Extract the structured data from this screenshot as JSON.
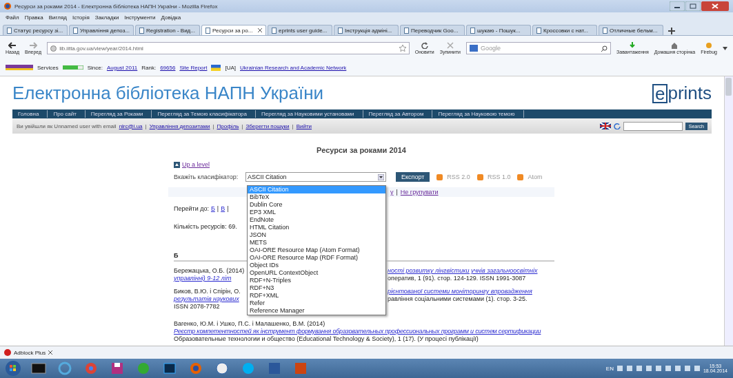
{
  "window": {
    "title": "Ресурси за роками 2014 - Електронна бібліотека НАПН України - Mozilla Firefox"
  },
  "menu": [
    "Файл",
    "Правка",
    "Вигляд",
    "Історія",
    "Закладки",
    "Інструменти",
    "Довідка"
  ],
  "tabs": [
    {
      "label": "Статус ресурсу зі...",
      "selected": false
    },
    {
      "label": "Управління депоз...",
      "selected": false
    },
    {
      "label": "Registration - Вид...",
      "selected": false
    },
    {
      "label": "Ресурси за ро...",
      "selected": true
    },
    {
      "label": "eprints user guide...",
      "selected": false
    },
    {
      "label": "Інструкція адміні...",
      "selected": false
    },
    {
      "label": "Переводчик Goo...",
      "selected": false
    },
    {
      "label": "шукаю - Пошук...",
      "selected": false
    },
    {
      "label": "Кроссовки с нат...",
      "selected": false
    },
    {
      "label": "Отличные бельм...",
      "selected": false
    }
  ],
  "toolbar": {
    "back": "Назад",
    "forward": "Вперед",
    "url": "lib.iitta.gov.ua/view/year/2014.html",
    "reload": "Оновити",
    "stop": "Зупинити",
    "search_placeholder": "Google",
    "downloads": "Завантаження",
    "home": "Домашня сторінка",
    "firebug": "Firebug"
  },
  "bookmarks": {
    "services": "Services",
    "since": "Since:",
    "since_date": "August 2011",
    "rank": "Rank:",
    "rank_value": "69656",
    "site_report": "Site Report",
    "network": "[UA]",
    "network_link": "Ukrainian Research and Academic Network"
  },
  "site": {
    "title": "Електронна бібліотека НАПН України",
    "logo_letter": "e",
    "logo_rest": "prints",
    "nav": [
      "Головна",
      "Про сайт",
      "Перегляд за Роками",
      "Перегляд за Темою класифікатора",
      "Перегляд за Науковими установами",
      "Перегляд за Автором",
      "Перегляд за Науковою темою"
    ],
    "login_text": "Ви увійшли як Unnamed user with email",
    "email": "nlrc@i.ua",
    "separator": "|",
    "links": [
      "Управління депозитами",
      "Профіль",
      "Зберегти пошуки",
      "Вийти"
    ],
    "search_button": "Search"
  },
  "content": {
    "heading": "Ресурси за роками 2014",
    "up_level": "Up a level",
    "export": {
      "label": "Вкажіть класифікатор:",
      "value": "ASCII Citation",
      "button": "Експорт",
      "feeds": [
        "RSS 2.0",
        "RSS 1.0",
        "Atom"
      ],
      "dropdown": {
        "expanded": true,
        "options": [
          {
            "label": "ASCII Citation",
            "selected": true
          },
          {
            "label": "BibTeX",
            "selected": false
          },
          {
            "label": "Dublin Core",
            "selected": false
          },
          {
            "label": "EP3 XML",
            "selected": false
          },
          {
            "label": "EndNote",
            "selected": false
          },
          {
            "label": "HTML Citation",
            "selected": false
          },
          {
            "label": "JSON",
            "selected": false
          },
          {
            "label": "METS",
            "selected": false
          },
          {
            "label": "OAI-ORE Resource Map (Atom Format)",
            "selected": false
          },
          {
            "label": "OAI-ORE Resource Map (RDF Format)",
            "selected": false
          },
          {
            "label": "Object IDs",
            "selected": false
          },
          {
            "label": "OpenURL ContextObject",
            "selected": false
          },
          {
            "label": "RDF+N-Triples",
            "selected": false
          },
          {
            "label": "RDF+N3",
            "selected": false
          },
          {
            "label": "RDF+XML",
            "selected": false
          },
          {
            "label": "Refer",
            "selected": false
          },
          {
            "label": "Reference Manager",
            "selected": false
          }
        ]
      }
    },
    "group_by": {
      "links": [
        "у",
        "Не групувати"
      ],
      "separator": "|"
    },
    "jump": {
      "label": "Перейти до:",
      "letters": [
        "Б",
        "В"
      ],
      "separator": "|"
    },
    "count": "Кількість ресурсів: 69.",
    "section": "Б",
    "split_entries": [
      {
        "lines": [
          {
            "left": [
              {
                "kind": "plain",
                "text": "Бережацька, О.Б. (2014)"
              }
            ],
            "right": [
              {
                "kind": "link",
                "text": "ності розвитку лінгвістики учнів загальноосвітніх"
              }
            ]
          },
          {
            "left": [
              {
                "kind": "link",
                "text": "управлінні) 9-12 літ"
              }
            ],
            "right": [
              {
                "kind": "plain",
                "text": "оператив, 1 (91). стор. 124-129. ISSN 1991-3087"
              }
            ]
          }
        ]
      },
      {
        "lines": [
          {
            "left": [
              {
                "kind": "plain",
                "text": "Биков, В.Ю. і Спірін, О."
              }
            ],
            "right": [
              {
                "kind": "link",
                "text": "рієнтованої системи моніторингу впровадження"
              }
            ]
          },
          {
            "left": [
              {
                "kind": "link",
                "text": "результатів наукових"
              }
            ],
            "right": [
              {
                "kind": "plain",
                "text": "равління соціальними системами (1). стор. 3-25."
              }
            ]
          },
          {
            "left": [
              {
                "kind": "plain",
                "text": "ISSN 2078-7782"
              }
            ]
          }
        ]
      }
    ],
    "entries": [
      {
        "authors": "Вагенко, Ю.М. і Ушко, П.С. і Малашенко, В.М. (2014)",
        "title": "Реєстр компетентностей як інструмент формування образовательных профессиональных программ и систем сертификации",
        "source": "Образовательные технологии и общество (Educational Technology & Society), 1 (17). (У процесі публікації)"
      }
    ]
  },
  "addon_bar": {
    "label": "Adblock Plus"
  },
  "taskbar": {
    "language": "EN",
    "time": "15:53",
    "date": "18.04.2014"
  }
}
